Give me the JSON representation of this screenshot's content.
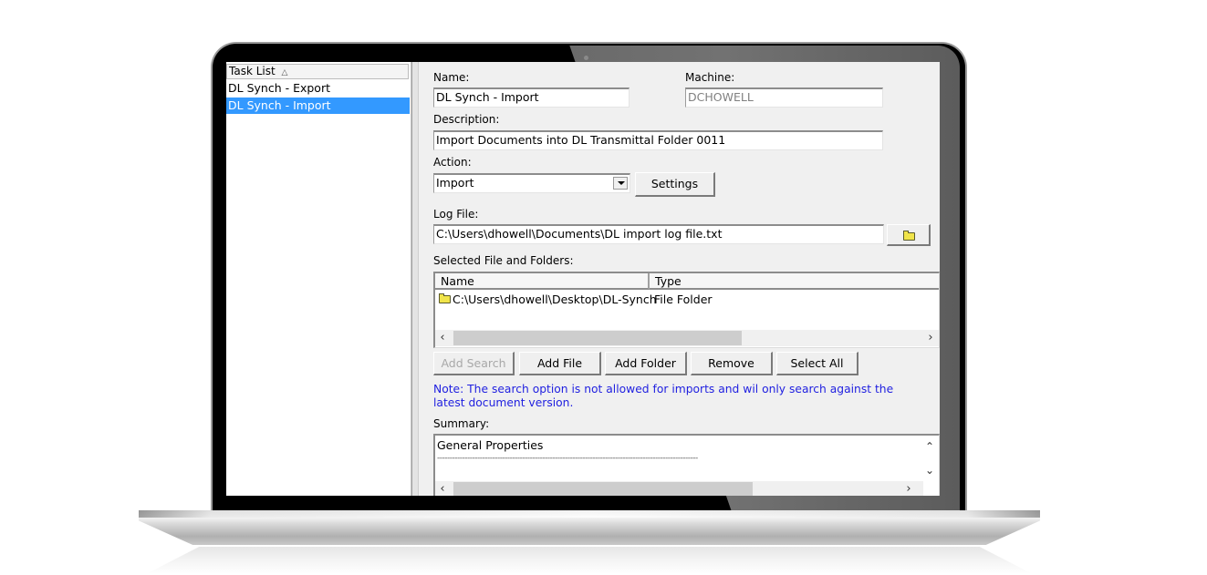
{
  "device": {
    "frame": "laptop"
  },
  "task_list": {
    "header": "Task List",
    "sort_icon": "sort-ascending-icon",
    "items": [
      {
        "label": "DL Synch - Export",
        "selected": false
      },
      {
        "label": "DL Synch - Import",
        "selected": true
      }
    ]
  },
  "form": {
    "name_label": "Name:",
    "name_value": "DL Synch - Import",
    "machine_label": "Machine:",
    "machine_value": "DCHOWELL",
    "description_label": "Description:",
    "description_value": "Import Documents into DL Transmittal Folder 0011",
    "action_label": "Action:",
    "action_value": "Import",
    "settings_button": "Settings",
    "log_file_label": "Log File:",
    "log_file_value": "C:\\Users\\dhowell\\Documents\\DL import log file.txt",
    "browse_icon": "folder-icon",
    "selected_label": "Selected File and Folders:",
    "columns": [
      "Name",
      "Type"
    ],
    "rows": [
      {
        "name": "C:\\Users\\dhowell\\Desktop\\DL-Synch",
        "type": "File Folder",
        "icon": "folder-icon"
      }
    ],
    "buttons": {
      "add_search": "Add Search",
      "add_file": "Add File",
      "add_folder": "Add Folder",
      "remove": "Remove",
      "select_all": "Select All"
    },
    "note": "Note: The search option is not allowed for imports and wil only search against the latest document version.",
    "summary_label": "Summary:",
    "summary_lines": [
      "General Properties",
      "--------------------------------------------------------------------------------------------------------"
    ]
  },
  "colors": {
    "selection": "#3399ff",
    "note_text": "#1f1fe0",
    "panel_bg": "#f0f0f0"
  }
}
